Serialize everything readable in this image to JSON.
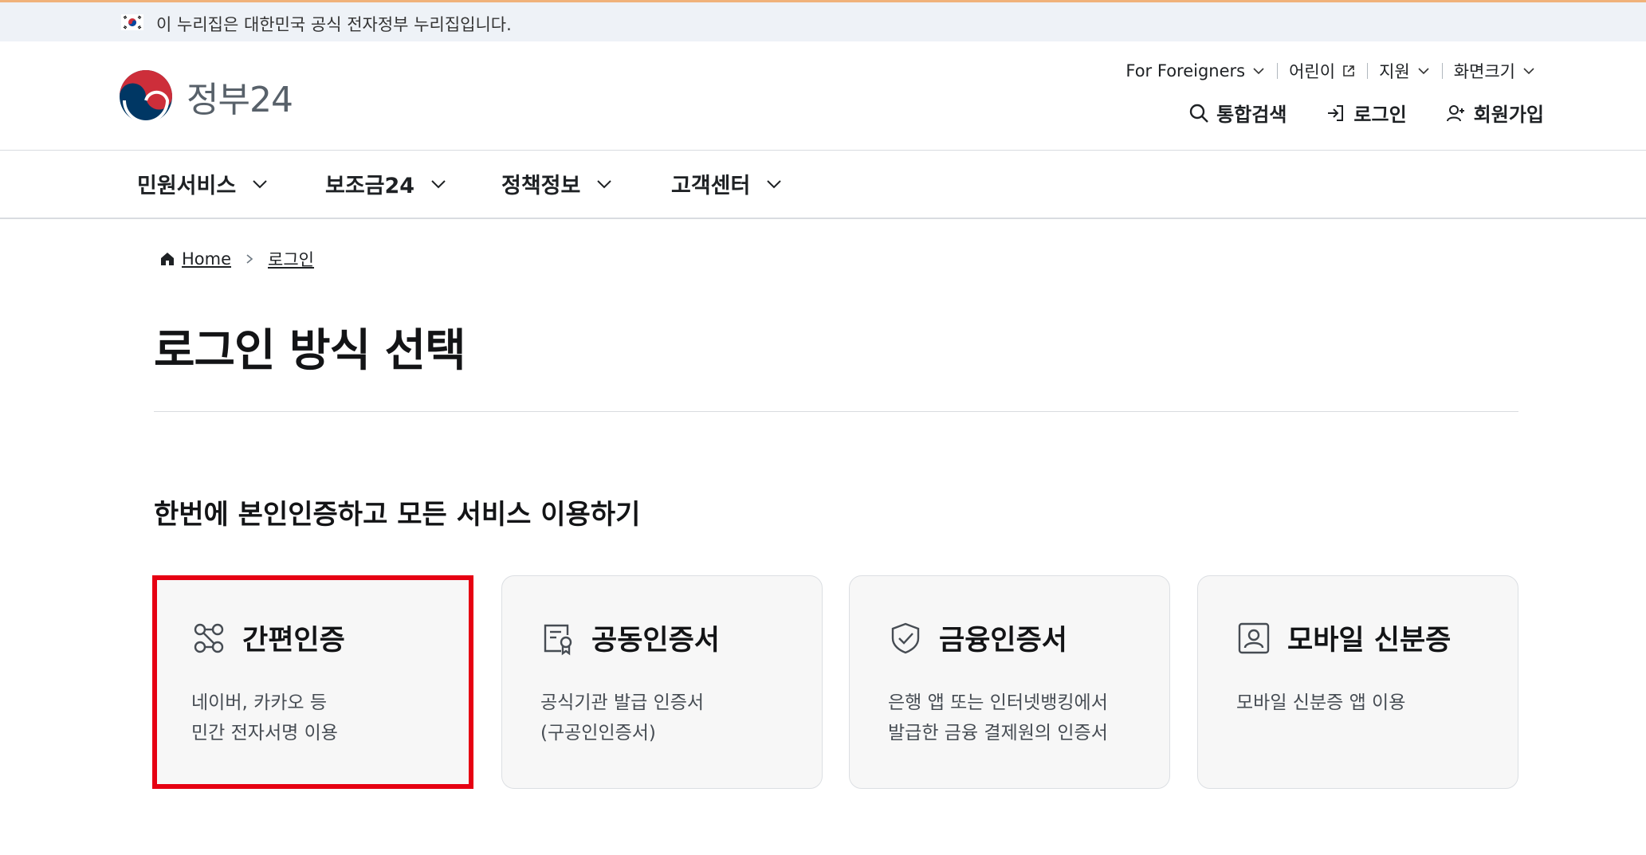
{
  "banner": {
    "text": "이 누리집은 대한민국 공식 전자정부 누리집입니다."
  },
  "logo": {
    "text": "정부24"
  },
  "util_nav": [
    {
      "label": "For Foreigners"
    },
    {
      "label": "어린이"
    },
    {
      "label": "지원"
    },
    {
      "label": "화면크기"
    }
  ],
  "actions": {
    "search": "통합검색",
    "login": "로그인",
    "signup": "회원가입"
  },
  "gnb": [
    {
      "label": "민원서비스"
    },
    {
      "label": "보조금24"
    },
    {
      "label": "정책정보"
    },
    {
      "label": "고객센터"
    }
  ],
  "breadcrumb": {
    "home": "Home",
    "current": "로그인"
  },
  "page_title": "로그인 방식 선택",
  "section_title": "한번에 본인인증하고 모든 서비스 이용하기",
  "cards": [
    {
      "title": "간편인증",
      "desc1": "네이버, 카카오 등",
      "desc2": "민간 전자서명 이용",
      "icon": "link-nodes-icon",
      "selected": true
    },
    {
      "title": "공동인증서",
      "desc1": "공식기관 발급 인증서",
      "desc2": "(구공인인증서)",
      "icon": "certificate-icon"
    },
    {
      "title": "금융인증서",
      "desc1": "은행 앱 또는 인터넷뱅킹에서",
      "desc2": "발급한 금융 결제원의 인증서",
      "icon": "shield-check-icon"
    },
    {
      "title": "모바일 신분증",
      "desc1": "모바일 신분증 앱 이용",
      "desc2": "",
      "icon": "id-card-icon"
    }
  ],
  "colors": {
    "highlight": "#e60012",
    "card_bg": "#f7f7f7",
    "text_dark": "#131416"
  }
}
